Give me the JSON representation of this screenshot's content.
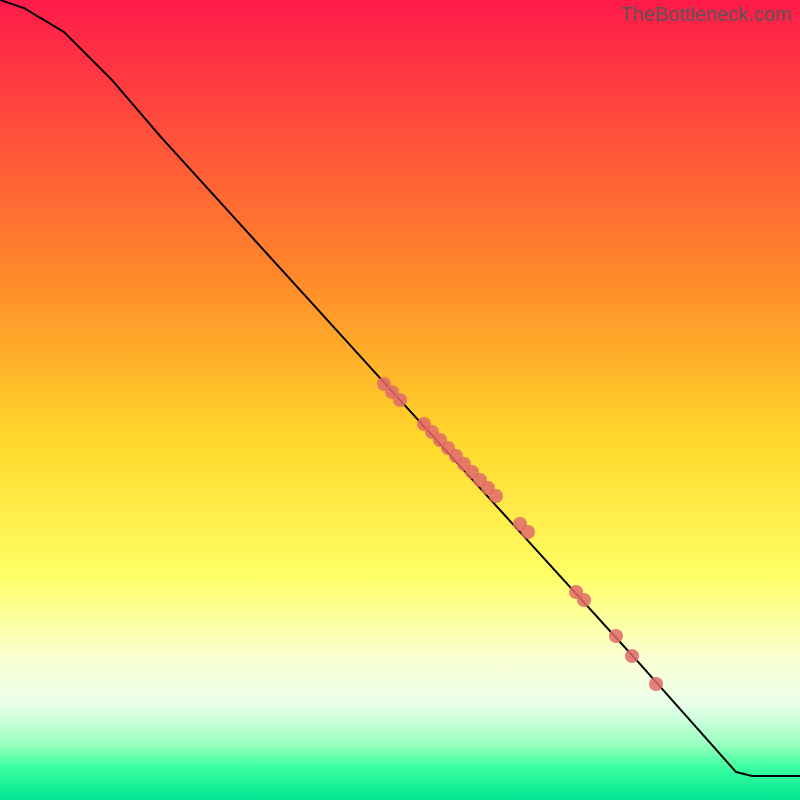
{
  "watermark": "TheBottleneck.com",
  "chart_data": {
    "type": "line",
    "title": "",
    "xlabel": "",
    "ylabel": "",
    "xlim": [
      0,
      100
    ],
    "ylim": [
      0,
      100
    ],
    "gradient_stops": [
      {
        "offset": 0,
        "color": "#ff1a4a"
      },
      {
        "offset": 35,
        "color": "#ff8a2a"
      },
      {
        "offset": 55,
        "color": "#ffd82a"
      },
      {
        "offset": 72,
        "color": "#ffff66"
      },
      {
        "offset": 82,
        "color": "#faffd0"
      },
      {
        "offset": 88,
        "color": "#eaffea"
      },
      {
        "offset": 93,
        "color": "#9affc0"
      },
      {
        "offset": 96,
        "color": "#3affa0"
      },
      {
        "offset": 100,
        "color": "#00e593"
      }
    ],
    "series": [
      {
        "name": "curve",
        "type": "line",
        "points": [
          {
            "x": 0,
            "y": 100
          },
          {
            "x": 3,
            "y": 99
          },
          {
            "x": 8,
            "y": 96
          },
          {
            "x": 14,
            "y": 90
          },
          {
            "x": 20,
            "y": 83
          },
          {
            "x": 30,
            "y": 72
          },
          {
            "x": 40,
            "y": 61
          },
          {
            "x": 50,
            "y": 50
          },
          {
            "x": 60,
            "y": 39
          },
          {
            "x": 70,
            "y": 28
          },
          {
            "x": 80,
            "y": 17
          },
          {
            "x": 88,
            "y": 8
          },
          {
            "x": 92,
            "y": 3.5
          },
          {
            "x": 94,
            "y": 3
          },
          {
            "x": 100,
            "y": 3
          }
        ]
      },
      {
        "name": "highlight-points",
        "type": "scatter",
        "points": [
          {
            "x": 48,
            "y": 52
          },
          {
            "x": 49,
            "y": 51
          },
          {
            "x": 50,
            "y": 50
          },
          {
            "x": 53,
            "y": 47
          },
          {
            "x": 54,
            "y": 46
          },
          {
            "x": 55,
            "y": 45
          },
          {
            "x": 56,
            "y": 44
          },
          {
            "x": 57,
            "y": 43
          },
          {
            "x": 58,
            "y": 42
          },
          {
            "x": 59,
            "y": 41
          },
          {
            "x": 60,
            "y": 40
          },
          {
            "x": 61,
            "y": 39
          },
          {
            "x": 62,
            "y": 38
          },
          {
            "x": 65,
            "y": 34.5
          },
          {
            "x": 66,
            "y": 33.5
          },
          {
            "x": 72,
            "y": 26
          },
          {
            "x": 73,
            "y": 25
          },
          {
            "x": 77,
            "y": 20.5
          },
          {
            "x": 79,
            "y": 18
          },
          {
            "x": 82,
            "y": 14.5
          }
        ]
      }
    ]
  }
}
